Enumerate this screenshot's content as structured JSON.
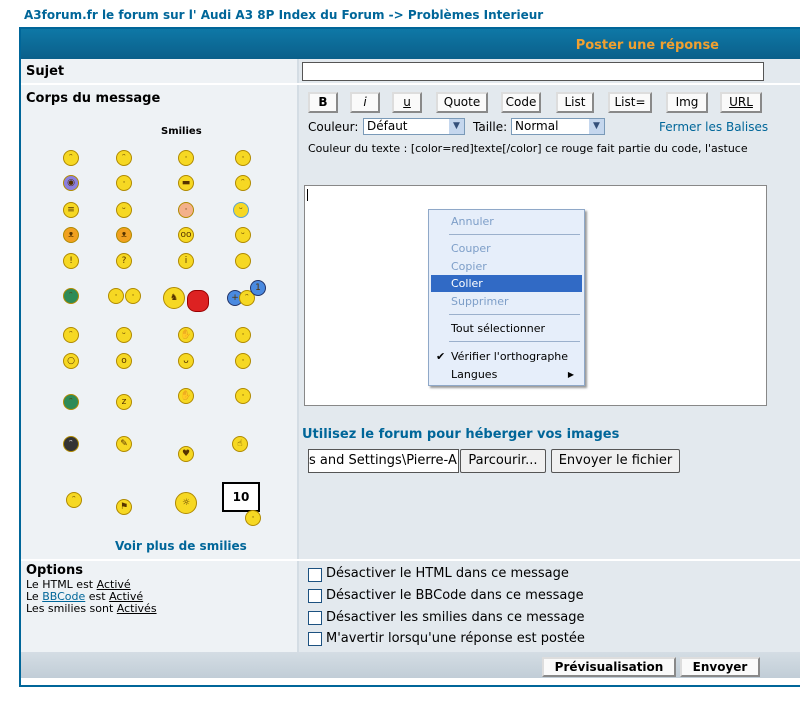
{
  "breadcrumb": {
    "site": "A3forum.fr le forum sur l' Audi A3 8P Index du Forum",
    "arrow": "->",
    "section": "Problèmes Interieur"
  },
  "header": {
    "title": "Poster une réponse"
  },
  "subject": {
    "label": "Sujet",
    "value": ""
  },
  "body": {
    "label": "Corps du message",
    "value": ""
  },
  "smilies": {
    "title": "Smilies",
    "more_link": "Voir plus de smilies"
  },
  "bbcode": {
    "buttons": [
      "B",
      "i",
      "u",
      "Quote",
      "Code",
      "List",
      "List=",
      "Img",
      "URL"
    ],
    "color_label": "Couleur:",
    "color_value": "Défaut",
    "size_label": "Taille:",
    "size_value": "Normal",
    "close_tags": "Fermer les Balises",
    "help_text": "Couleur du texte : [color=red]texte[/color] ce rouge fait partie du code, l'astuce"
  },
  "context_menu": {
    "undo": "Annuler",
    "cut": "Couper",
    "copy": "Copier",
    "paste": "Coller",
    "delete": "Supprimer",
    "select_all": "Tout sélectionner",
    "spellcheck": "Vérifier l'orthographe",
    "languages": "Langues"
  },
  "upload": {
    "title": "Utilisez le forum pour héberger vos images",
    "file_path": "s and Settings\\Pierre-Ale",
    "browse": "Parcourir...",
    "send": "Envoyer le fichier"
  },
  "options": {
    "title": "Options",
    "html_line": [
      "Le HTML est",
      "Activé"
    ],
    "bbcode_line": [
      "Le",
      "BBCode",
      "est",
      "Activé"
    ],
    "smilies_line": [
      "Les smilies sont",
      "Activés"
    ],
    "checkboxes": [
      "Désactiver le HTML dans ce message",
      "Désactiver le BBCode dans ce message",
      "Désactiver les smilies dans ce message",
      "M'avertir lorsqu'une réponse est postée"
    ]
  },
  "actions": {
    "preview": "Prévisualisation",
    "submit": "Envoyer"
  },
  "colors": {
    "link": "#006699",
    "header_bar": "#0f78a6",
    "header_text": "#f0a030",
    "menu_highlight": "#316ac5"
  }
}
